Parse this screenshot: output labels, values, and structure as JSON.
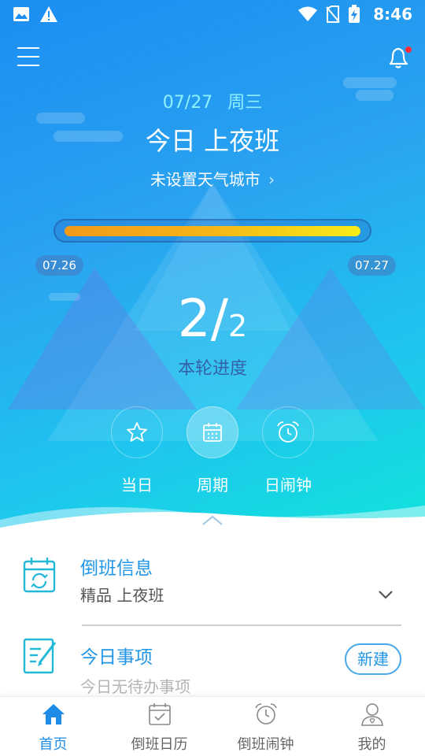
{
  "status_bar": {
    "time": "8:46",
    "icons": [
      "image-icon",
      "warning-icon",
      "wifi-icon",
      "no-sim-icon",
      "battery-charging-icon"
    ]
  },
  "header": {
    "date": "07/27",
    "weekday": "周三",
    "title": "今日 上夜班",
    "weather_prompt": "未设置天气城市",
    "weather_chevron": "›",
    "notification_dot": true
  },
  "progress": {
    "fraction": 1.0,
    "start_date": "07.26",
    "end_date": "07.27",
    "current": "2",
    "separator": "/",
    "total": "2",
    "label": "本轮进度"
  },
  "quick_actions": [
    {
      "label": "当日",
      "icon": "star-icon",
      "active": false
    },
    {
      "label": "周期",
      "icon": "calendar-icon",
      "active": true
    },
    {
      "label": "日闹钟",
      "icon": "alarm-icon",
      "active": false
    }
  ],
  "shift_info": {
    "title": "倒班信息",
    "value": "精品 上夜班"
  },
  "todo": {
    "title": "今日事项",
    "empty_text": "今日无待办事项",
    "new_label": "新建"
  },
  "bottom_nav": [
    {
      "label": "首页",
      "icon": "home-icon",
      "active": true
    },
    {
      "label": "倒班日历",
      "icon": "calendar-icon",
      "active": false
    },
    {
      "label": "倒班闹钟",
      "icon": "alarm-clock-icon",
      "active": false
    },
    {
      "label": "我的",
      "icon": "user-icon",
      "active": false
    }
  ],
  "colors": {
    "accent": "#2196e6",
    "progress_start": "#f29a1a",
    "progress_end": "#f7ec1a",
    "date_text": "#8ff0ff"
  }
}
